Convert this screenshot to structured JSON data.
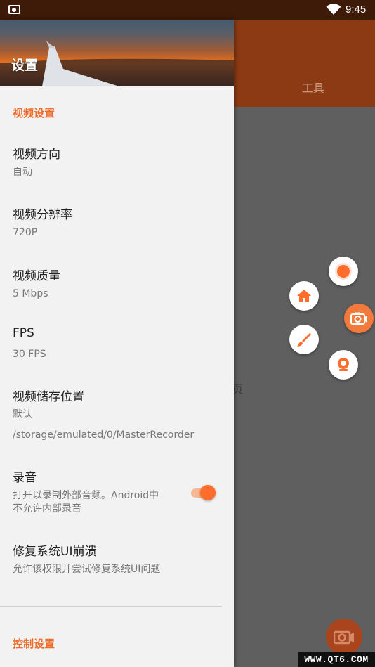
{
  "status_bar": {
    "time": "9:45",
    "notification_icon": "camera-notification-icon",
    "wifi_icon": "wifi-icon"
  },
  "background_app": {
    "tab_label": "工具",
    "partial_text": "页"
  },
  "drawer": {
    "header_title": "设置",
    "sections": [
      {
        "title": "视频设置"
      },
      {
        "title": "控制设置"
      }
    ],
    "prefs": {
      "orientation": {
        "title": "视频方向",
        "value": "自动"
      },
      "resolution": {
        "title": "视频分辨率",
        "value": "720P"
      },
      "quality": {
        "title": "视频质量",
        "value": "5 Mbps"
      },
      "fps": {
        "title": "FPS",
        "value": "30 FPS"
      },
      "storage": {
        "title": "视频储存位置",
        "value": "默认",
        "path": "/storage/emulated/0/MasterRecorder"
      },
      "audio": {
        "title": "录音",
        "desc_line1": "打开以录制外部音频。Android中",
        "desc_line2": "不允许内部录音",
        "enabled": true
      },
      "fix_ui": {
        "title": "修复系统UI崩溃",
        "desc": "允许该权限并尝试修复系统UI问题"
      }
    }
  },
  "floating_menu": {
    "items": [
      "record-icon",
      "home-icon",
      "camera-icon",
      "brush-icon",
      "webcam-icon"
    ]
  },
  "watermark": "WWW.QT6.COM",
  "colors": {
    "accent": "#f06b2a",
    "status_bar": "#3e1a08",
    "app_bar": "#8c3a14",
    "scrim": "#5f5f5f"
  }
}
